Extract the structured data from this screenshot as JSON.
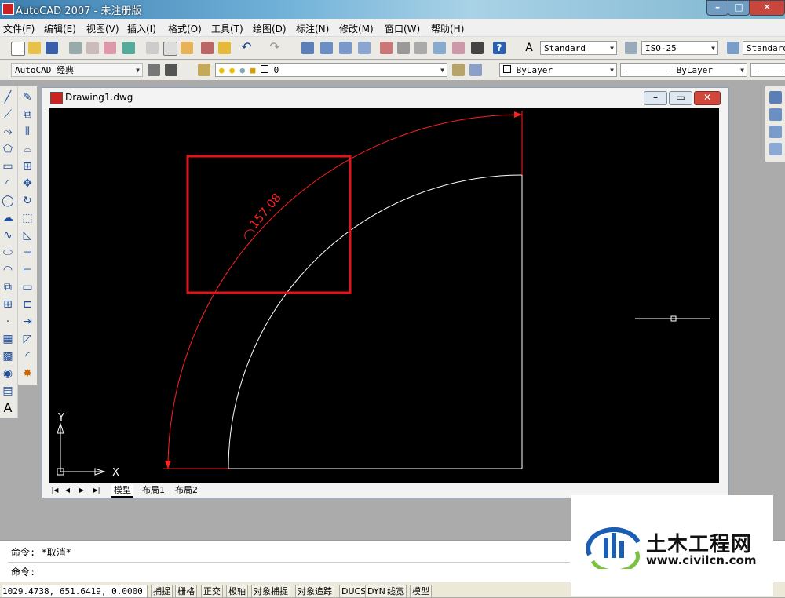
{
  "window": {
    "title": "AutoCAD 2007 - 未注册版"
  },
  "menu": [
    "文件(F)",
    "编辑(E)",
    "视图(V)",
    "插入(I)",
    "格式(O)",
    "工具(T)",
    "绘图(D)",
    "标注(N)",
    "修改(M)",
    "窗口(W)",
    "帮助(H)"
  ],
  "toolbar": {
    "text_style": "Standard",
    "dim_style": "ISO-25",
    "table_style": "Standard",
    "workspace": "AutoCAD 经典",
    "layer": "0",
    "color": "ByLayer",
    "linetype": "ByLayer"
  },
  "drawing": {
    "filename": "Drawing1.dwg",
    "dimension_text": "157.08",
    "ucs_x": "X",
    "ucs_y": "Y",
    "colors": {
      "background": "#000000",
      "dimension": "#ff0000",
      "geometry": "#ffffff",
      "highlight": "#e0141e"
    }
  },
  "tabs": [
    "模型",
    "布局1",
    "布局2"
  ],
  "command": {
    "line1": "命令: *取消*",
    "line2": "命令:"
  },
  "status": {
    "coords": "1029.4738,  651.6419,  0.0000",
    "buttons": [
      "捕捉",
      "栅格",
      "正交",
      "极轴",
      "对象捕捉",
      "对象追踪",
      "DUCS",
      "DYN",
      "线宽",
      "模型"
    ]
  },
  "watermark": {
    "brand": "土木工程网",
    "url": "www.civilcn.com"
  }
}
